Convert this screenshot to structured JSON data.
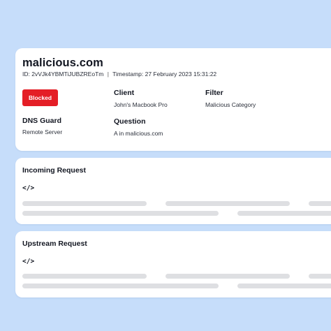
{
  "event": {
    "domain": "malicious.com",
    "id_text": "ID: 2vVJk4YBMTiJUBZREoTm",
    "separator": "|",
    "timestamp_text": "Timestamp: 27 February 2023 15:31:22",
    "status_badge": "Blocked",
    "client": {
      "label": "Client",
      "value": "John's Macbook Pro"
    },
    "filter": {
      "label": "Filter",
      "value": "Malicious Category"
    },
    "dns_guard": {
      "label": "DNS Guard",
      "value": "Remote Server"
    },
    "question": {
      "label": "Question",
      "value": "A in malicious.com"
    }
  },
  "incoming_request": {
    "title": "Incoming Request",
    "code_icon": "</>"
  },
  "upstream_request": {
    "title": "Upstream Request",
    "code_icon": "</>"
  },
  "colors": {
    "background": "#c6ddfa",
    "card": "#ffffff",
    "blocked": "#e41e26",
    "placeholder": "#dedfe2",
    "text": "#131722"
  },
  "icons": {
    "code": "code-brackets-icon"
  }
}
